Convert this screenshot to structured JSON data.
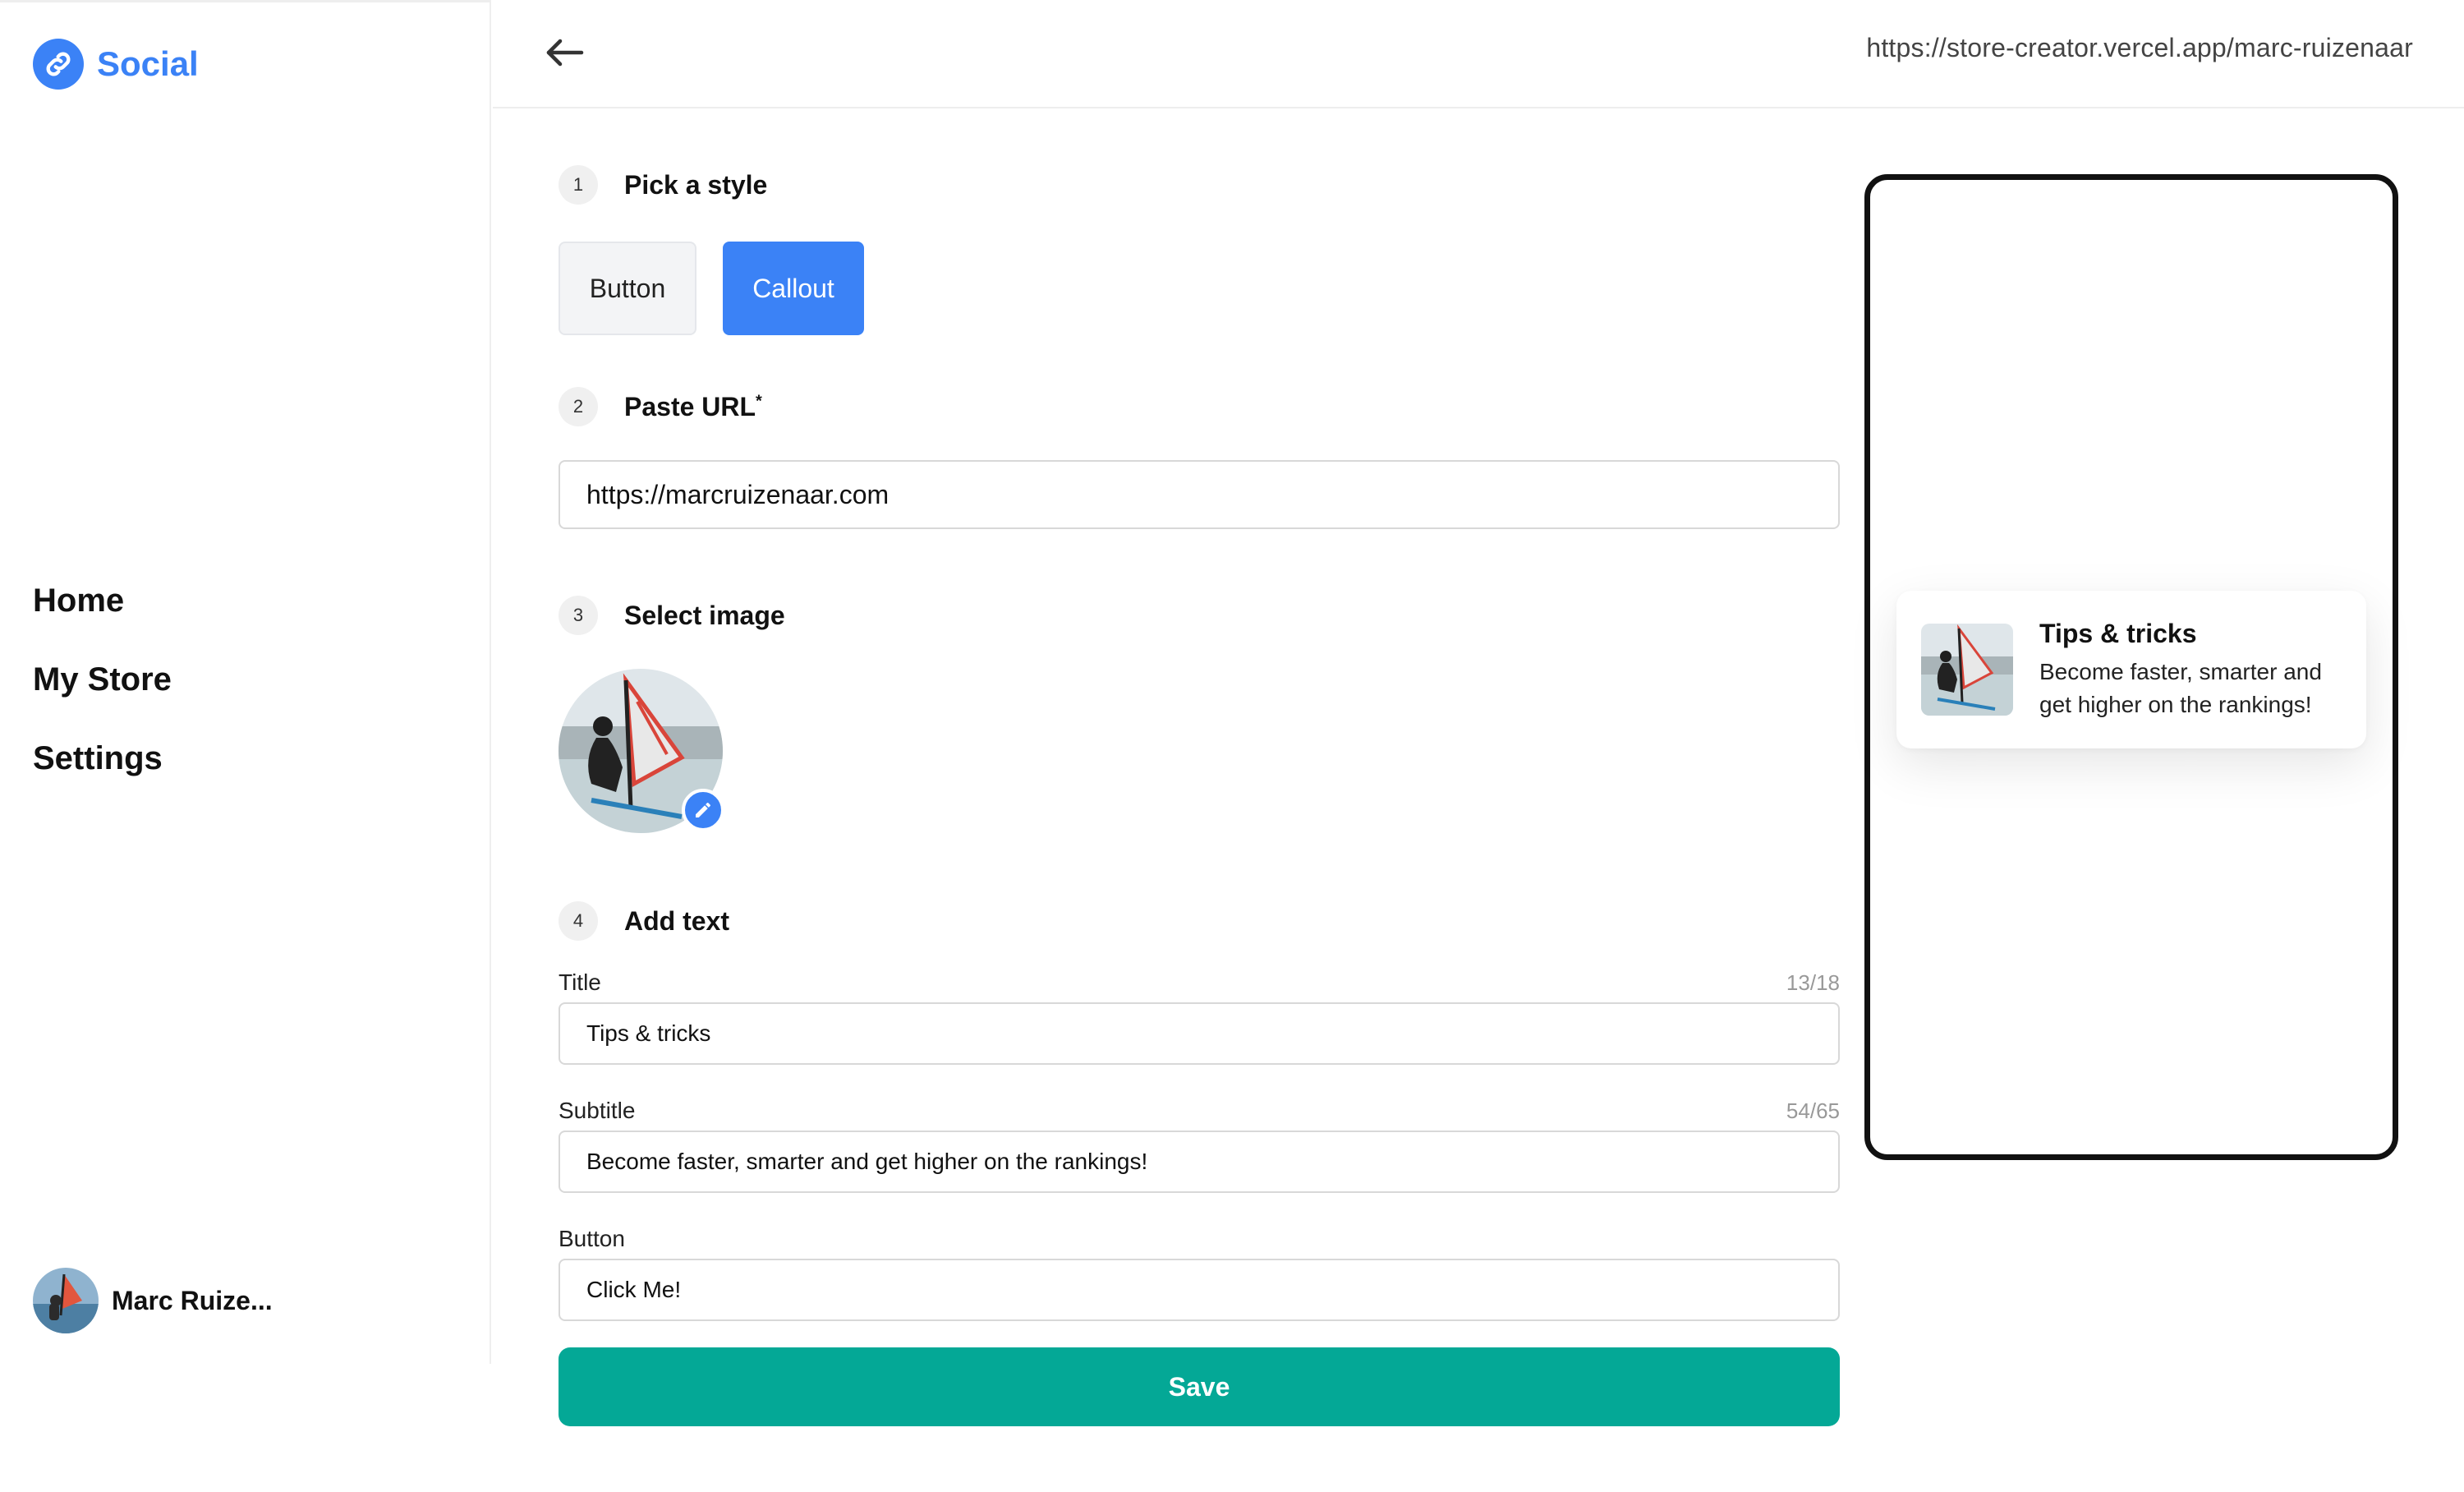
{
  "app": {
    "name": "Social",
    "brand_color": "#3b82f6",
    "save_color": "#04a896"
  },
  "sidebar": {
    "items": [
      {
        "label": "Home"
      },
      {
        "label": "My Store"
      },
      {
        "label": "Settings"
      }
    ],
    "user": {
      "name": "Marc Ruize..."
    }
  },
  "header": {
    "back_icon": "arrow-left-icon",
    "store_url": "https://store-creator.vercel.app/marc-ruizenaar"
  },
  "form": {
    "steps": [
      {
        "num": "1",
        "title": "Pick a style"
      },
      {
        "num": "2",
        "title": "Paste URL",
        "required_mark": "*"
      },
      {
        "num": "3",
        "title": "Select image"
      },
      {
        "num": "4",
        "title": "Add text"
      }
    ],
    "style_options": [
      {
        "label": "Button",
        "selected": false
      },
      {
        "label": "Callout",
        "selected": true
      }
    ],
    "url_value": "https://marcruizenaar.com",
    "fields": {
      "title": {
        "label": "Title",
        "value": "Tips & tricks",
        "count": "13/18"
      },
      "subtitle": {
        "label": "Subtitle",
        "value": "Become faster, smarter and get higher on the rankings!",
        "count": "54/65"
      },
      "button": {
        "label": "Button",
        "value": "Click Me!"
      }
    },
    "save_label": "Save"
  },
  "preview": {
    "title": "Tips & tricks",
    "subtitle": "Become faster, smarter and get higher on the rankings!"
  }
}
